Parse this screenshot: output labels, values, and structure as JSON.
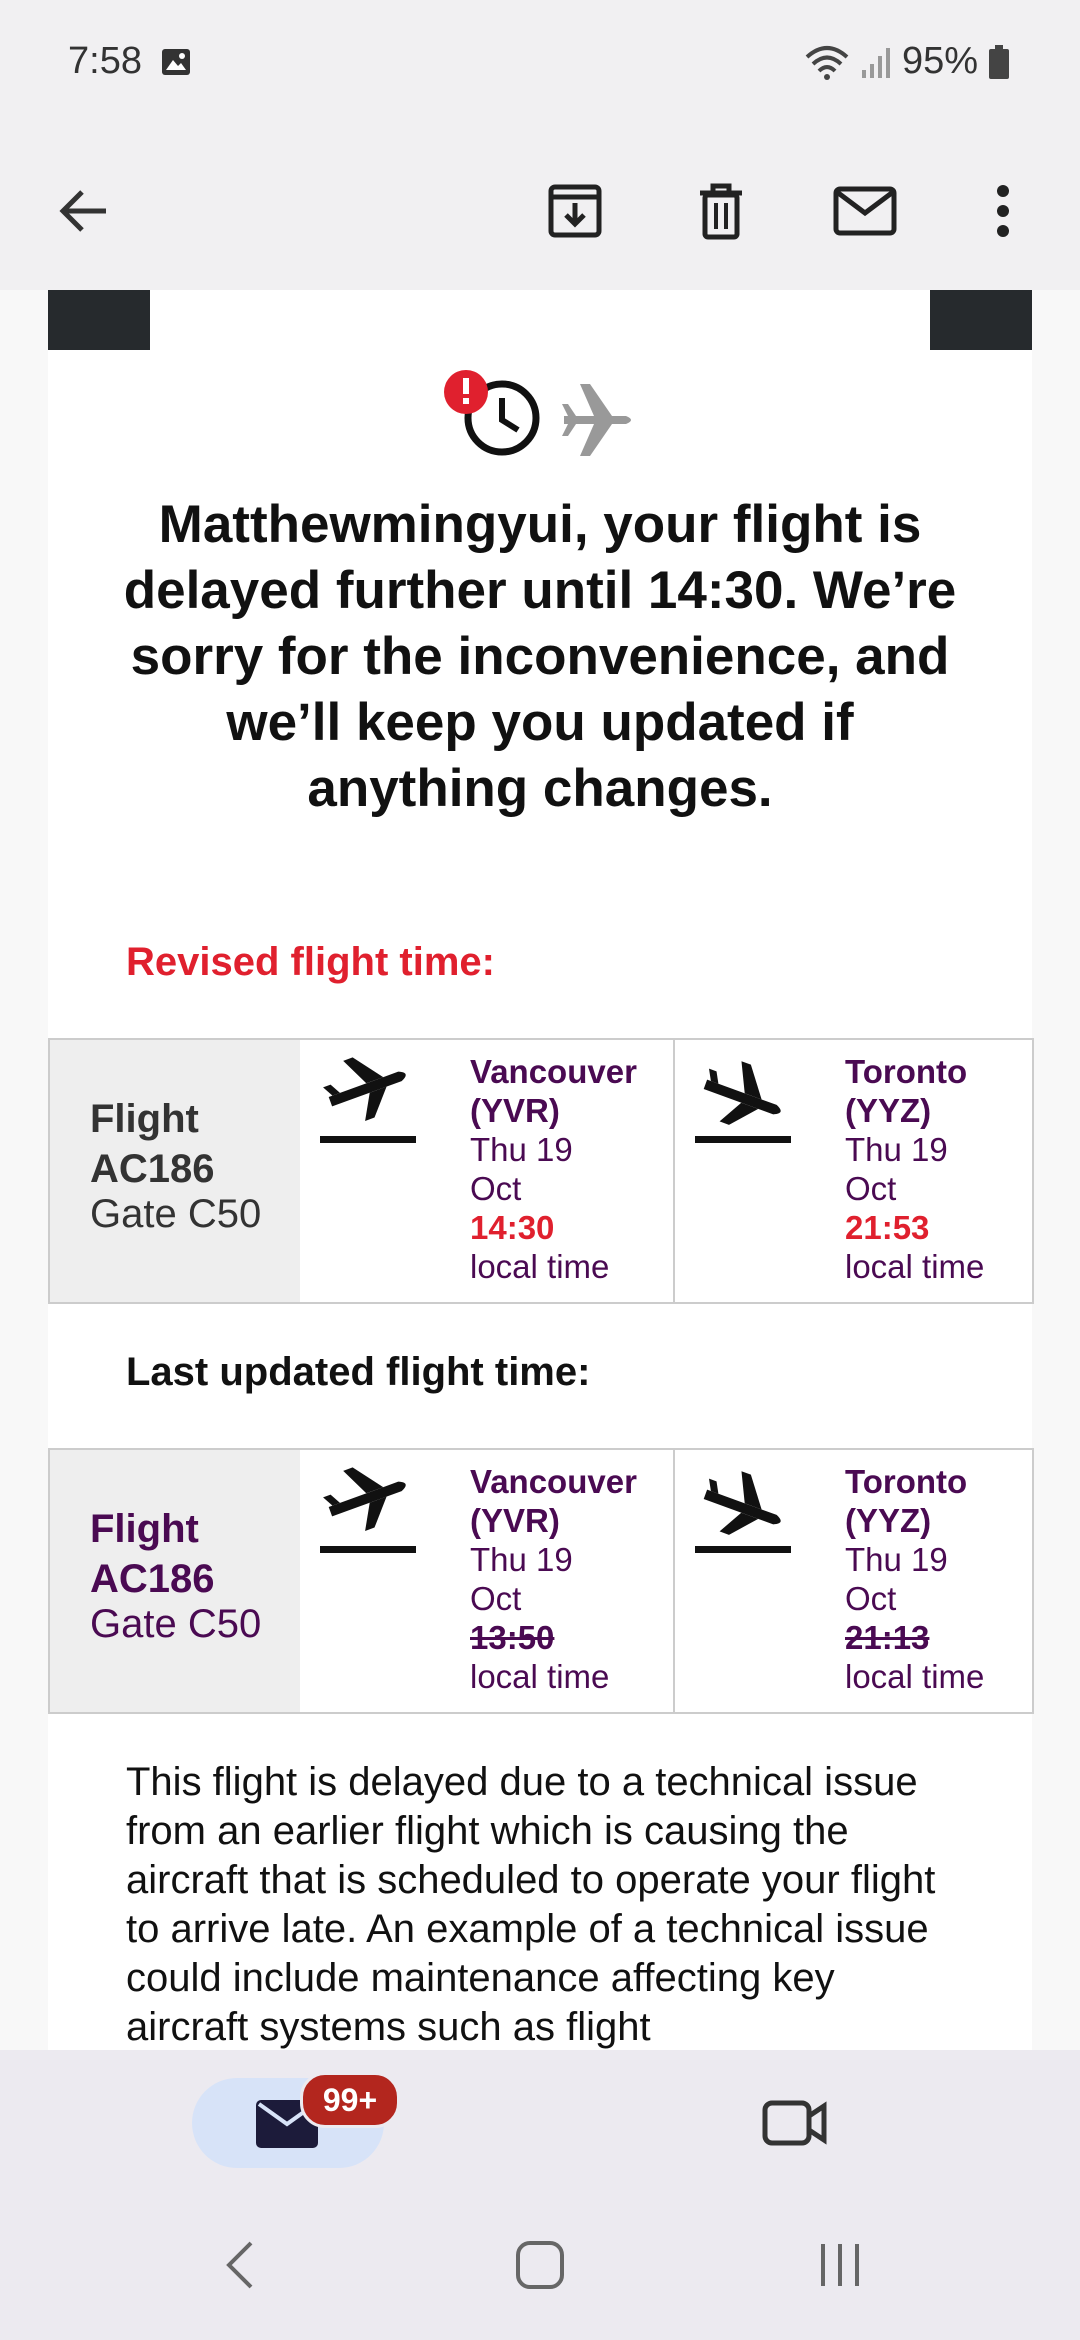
{
  "status_bar": {
    "time": "7:58",
    "battery": "95%",
    "icons": [
      "gallery-icon",
      "wifi-icon",
      "signal-icon",
      "battery-icon"
    ]
  },
  "app_bar": {
    "icons": [
      "back-arrow-icon",
      "archive-icon",
      "delete-icon",
      "mark-unread-icon",
      "more-vert-icon"
    ]
  },
  "email": {
    "headline": "Matthewmingyui, your flight is delayed further until 14:30. We’re sorry for the inconvenience, and we’ll keep you updated if anything changes.",
    "revised_label": "Revised flight time:",
    "last_label": "Last updated flight time:",
    "revised": {
      "flight": "Flight AC186",
      "gate": "Gate C50",
      "departure": {
        "city": "Vancouver (YVR)",
        "date": "Thu 19 Oct",
        "time": "14:30",
        "note": "local time"
      },
      "arrival": {
        "city": "Toronto (YYZ)",
        "date": "Thu 19 Oct",
        "time": "21:53",
        "note": "local time"
      }
    },
    "previous": {
      "flight": "Flight AC186",
      "gate": "Gate C50",
      "departure": {
        "city": "Vancouver (YVR)",
        "date": "Thu 19 Oct",
        "time": "13:50",
        "note": "local time"
      },
      "arrival": {
        "city": "Toronto (YYZ)",
        "date": "Thu 19 Oct",
        "time": "21:13",
        "note": "local time"
      }
    },
    "body": "This flight is delayed due to a technical issue from an earlier flight which is causing the aircraft that is scheduled to operate your flight to arrive late. An example of a technical issue could include maintenance affecting key aircraft systems such as flight"
  },
  "bottom_nav": {
    "mail_badge": "99+",
    "items": [
      "mail-icon",
      "meet-video-icon"
    ]
  },
  "colors": {
    "alert_red": "#e0202e",
    "brand_purple": "#4a0a52",
    "badge_red": "#b3261e"
  }
}
